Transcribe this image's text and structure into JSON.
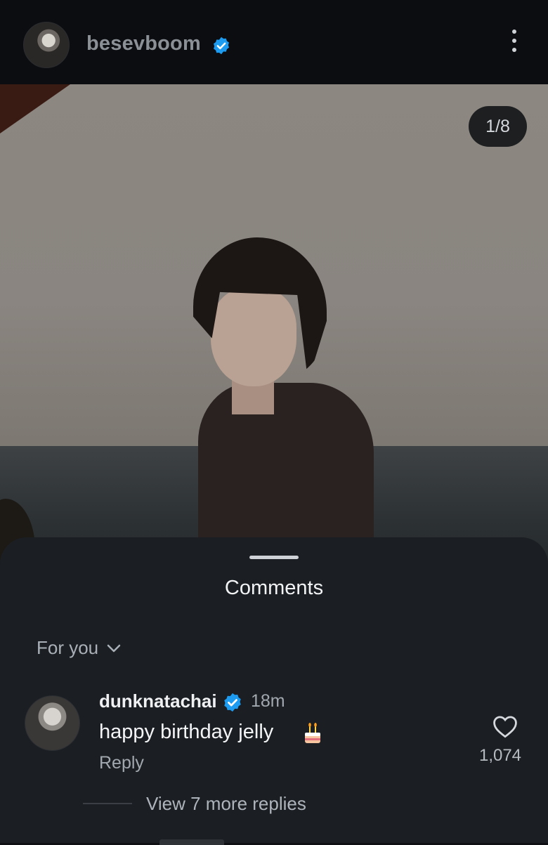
{
  "header": {
    "username": "besevboom",
    "verified": true
  },
  "post": {
    "image_counter": "1/8"
  },
  "comments_sheet": {
    "title": "Comments",
    "filter_label": "For you",
    "comments": [
      {
        "username": "dunknatachai",
        "verified": true,
        "time": "18m",
        "text": "happy birthday jelly",
        "emoji_icon": "birthday-cake-icon",
        "reply_label": "Reply",
        "like_count": "1,074",
        "view_replies_label": "View 7 more replies"
      }
    ]
  },
  "colors": {
    "verified_blue": "#1d9bf0",
    "sheet_bg": "#1b1e22",
    "topbar_bg": "#0c0d10"
  }
}
